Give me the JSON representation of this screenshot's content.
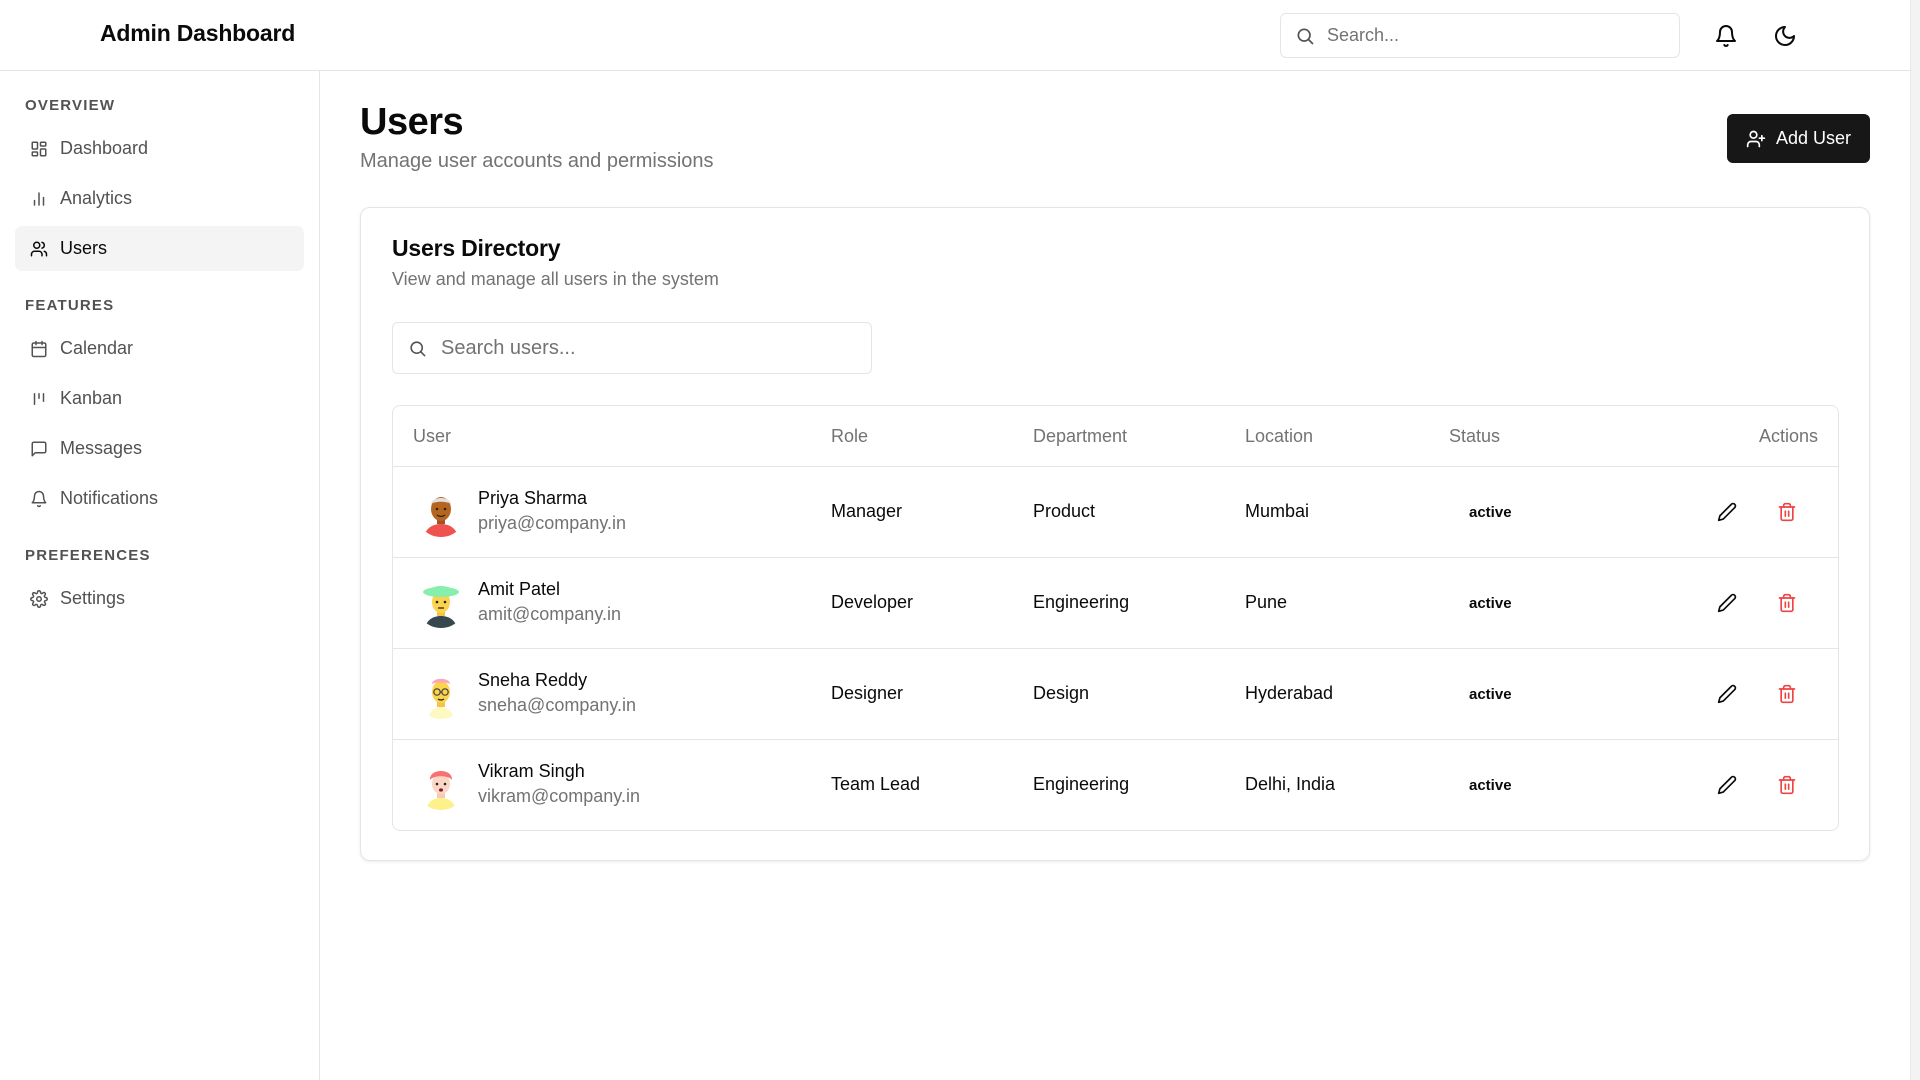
{
  "header": {
    "title": "Admin Dashboard",
    "search_placeholder": "Search...",
    "icons": [
      "search-icon",
      "bell-icon",
      "moon-icon"
    ]
  },
  "sidebar": {
    "sections": [
      {
        "title": "OVERVIEW",
        "items": [
          {
            "label": "Dashboard",
            "icon": "layout-grid-icon",
            "active": false
          },
          {
            "label": "Analytics",
            "icon": "bar-chart-icon",
            "active": false
          },
          {
            "label": "Users",
            "icon": "users-icon",
            "active": true
          }
        ]
      },
      {
        "title": "FEATURES",
        "items": [
          {
            "label": "Calendar",
            "icon": "calendar-icon",
            "active": false
          },
          {
            "label": "Kanban",
            "icon": "kanban-icon",
            "active": false
          },
          {
            "label": "Messages",
            "icon": "message-icon",
            "active": false
          },
          {
            "label": "Notifications",
            "icon": "bell-icon",
            "active": false
          }
        ]
      },
      {
        "title": "PREFERENCES",
        "items": [
          {
            "label": "Settings",
            "icon": "gear-icon",
            "active": false
          }
        ]
      }
    ]
  },
  "main": {
    "title": "Users",
    "subtitle": "Manage user accounts and permissions",
    "add_button_label": "Add User",
    "card": {
      "title": "Users Directory",
      "description": "View and manage all users in the system",
      "search_placeholder": "Search users...",
      "columns": [
        "User",
        "Role",
        "Department",
        "Location",
        "Status",
        "Actions"
      ],
      "rows": [
        {
          "name": "Priya Sharma",
          "email": "priya@company.in",
          "role": "Manager",
          "department": "Product",
          "location": "Mumbai",
          "status": "active"
        },
        {
          "name": "Amit Patel",
          "email": "amit@company.in",
          "role": "Developer",
          "department": "Engineering",
          "location": "Pune",
          "status": "active"
        },
        {
          "name": "Sneha Reddy",
          "email": "sneha@company.in",
          "role": "Designer",
          "department": "Design",
          "location": "Hyderabad",
          "status": "active"
        },
        {
          "name": "Vikram Singh",
          "email": "vikram@company.in",
          "role": "Team Lead",
          "department": "Engineering",
          "location": "Delhi, India",
          "status": "active"
        }
      ]
    }
  },
  "colors": {
    "primary": "#171717",
    "muted_text": "#737373",
    "border": "#e5e5e5",
    "danger": "#ef4444",
    "active_nav_bg": "#f4f4f5"
  }
}
